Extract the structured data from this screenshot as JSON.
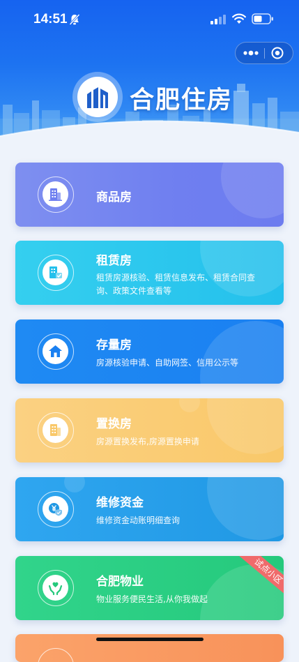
{
  "status_bar": {
    "time": "14:51"
  },
  "header": {
    "brand_title": "合肥住房"
  },
  "icons": {
    "bell": "bell-slash-icon",
    "signal": "cellular-signal-icon",
    "wifi": "wifi-icon",
    "battery": "battery-icon",
    "more": "more-dots-icon",
    "close": "close-miniprogram-icon"
  },
  "services": [
    {
      "title": "商品房",
      "icon": "building-icon"
    },
    {
      "title": "租赁房",
      "description": "租赁房源核验、租赁信息发布、租赁合同查询、政策文件查看等",
      "icon": "rental-building-icon"
    },
    {
      "title": "存量房",
      "description": "房源核验申请、自助网签、信用公示等",
      "icon": "house-icon"
    },
    {
      "title": "置换房",
      "description": "房源置换发布,房源置换申请",
      "icon": "exchange-building-icon"
    },
    {
      "title": "维修资金",
      "description": "维修资金动账明细查询",
      "icon": "yuan-shield-icon"
    },
    {
      "title": "合肥物业",
      "description": "物业服务便民生活,从你我做起",
      "badge": "试点小区",
      "icon": "hand-heart-icon"
    }
  ],
  "colors": {
    "header_blue": "#1663f0",
    "commodity": "#6f7ff0",
    "rental": "#24c0ec",
    "existing": "#1a80f1",
    "exchange": "#f9c869",
    "maintenance_fund": "#2098e4",
    "property": "#25c97c",
    "badge_red": "#f06b6b"
  }
}
